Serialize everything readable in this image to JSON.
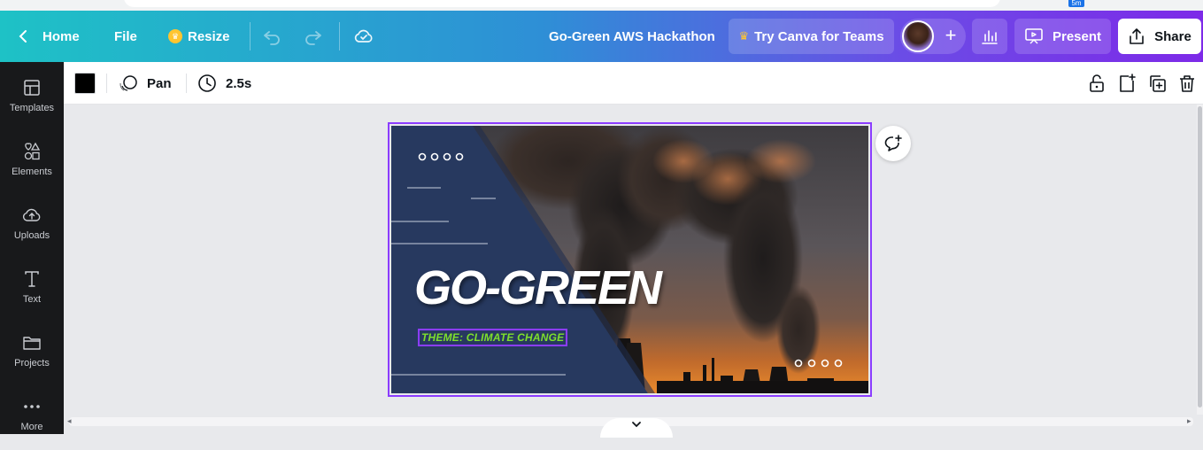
{
  "topbar": {
    "home_label": "Home",
    "file_label": "File",
    "resize_label": "Resize",
    "document_title": "Go-Green AWS Hackathon",
    "teams_label": "Try Canva for Teams",
    "present_label": "Present",
    "share_label": "Share",
    "add_people_symbol": "+"
  },
  "browser": {
    "extension_badge": "5m"
  },
  "sidebar": {
    "items": [
      {
        "label": "Templates",
        "icon": "templates-icon"
      },
      {
        "label": "Elements",
        "icon": "elements-icon"
      },
      {
        "label": "Uploads",
        "icon": "uploads-icon"
      },
      {
        "label": "Text",
        "icon": "text-icon"
      },
      {
        "label": "Projects",
        "icon": "folder-icon"
      },
      {
        "label": "More",
        "icon": "more-icon"
      }
    ]
  },
  "toolbar": {
    "color": "#000000",
    "animation_label": "Pan",
    "duration_label": "2.5s"
  },
  "slide": {
    "title": "GO-GREEN",
    "theme": "THEME: CLIMATE CHANGE"
  },
  "colors": {
    "accent_purple": "#8b3dff",
    "navy_panel": "#27395f",
    "theme_green": "#7ee02c"
  }
}
